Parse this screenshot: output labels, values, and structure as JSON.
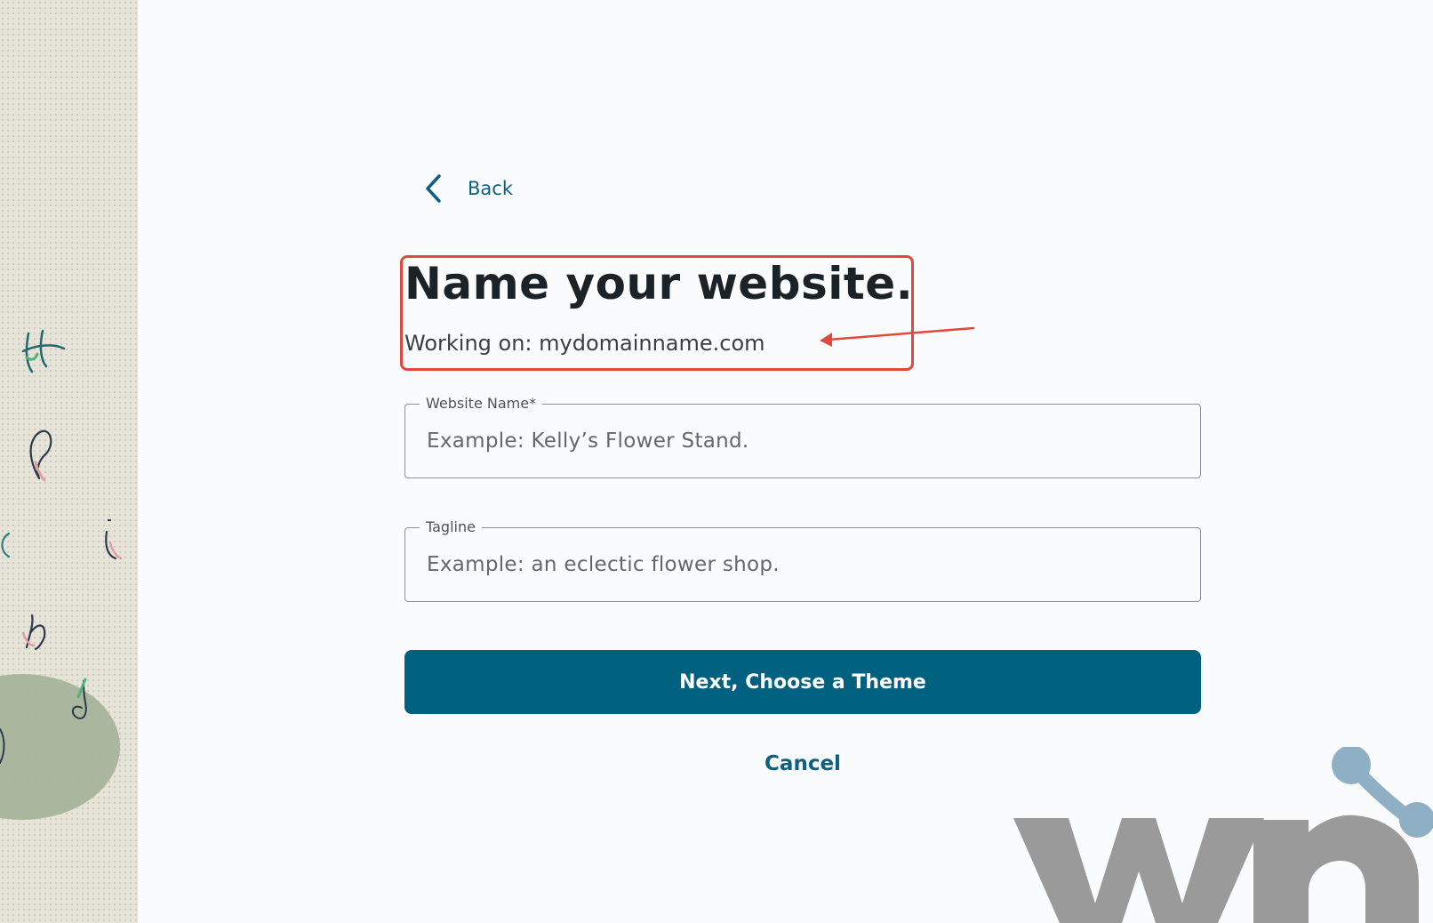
{
  "nav": {
    "back_label": "Back"
  },
  "header": {
    "title": "Name your website.",
    "subtitle": "Working on: mydomainname.com"
  },
  "form": {
    "website_name": {
      "label": "Website Name*",
      "placeholder": "Example: Kelly’s Flower Stand.",
      "value": ""
    },
    "tagline": {
      "label": "Tagline",
      "placeholder": "Example: an eclectic flower shop.",
      "value": ""
    }
  },
  "actions": {
    "next_label": "Next, Choose a Theme",
    "cancel_label": "Cancel"
  },
  "colors": {
    "accent": "#00607f",
    "link": "#0e5f80",
    "annotation": "#e04a3c",
    "panel_background": "#e6e4d8"
  },
  "icons": {
    "back": "chevron-left-icon"
  }
}
